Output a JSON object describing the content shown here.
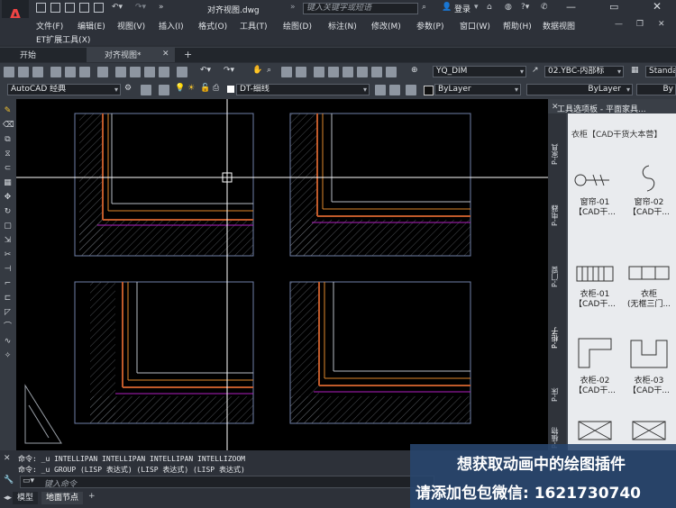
{
  "window": {
    "title": "对齐视图.dwg",
    "search_placeholder": "键入关键字或短语",
    "login_label": "登录"
  },
  "menu": [
    "文件(F)",
    "编辑(E)",
    "视图(V)",
    "插入(I)",
    "格式(O)",
    "工具(T)",
    "绘图(D)",
    "标注(N)",
    "修改(M)",
    "参数(P)",
    "窗口(W)",
    "帮助(H)",
    "数据视图"
  ],
  "et_menu": "ET扩展工具(X)",
  "tabs": [
    {
      "label": "开始"
    },
    {
      "label": "对齐视图*"
    }
  ],
  "toolbar": {
    "dim_style": "YQ_DIM",
    "text_style": "02.YBC-内部标",
    "table_style": "Standa",
    "workspace": "AutoCAD 经典",
    "layer": "DT-细线",
    "color": "ByLayer",
    "linetype": "ByLayer",
    "lineweight": "By"
  },
  "palette": {
    "title": "工具选项板 - 平面家具...",
    "subtitle": "衣柜【CAD干货大本营】",
    "side_tabs": [
      "P-家具",
      "P-电器",
      "P-门窗",
      "P-柜子",
      "P-床",
      "P-植物"
    ],
    "items": [
      {
        "label1": "窗帘-01",
        "label2": "【CAD干..."
      },
      {
        "label1": "窗帘-02",
        "label2": "【CAD干..."
      },
      {
        "label1": "衣柜-01",
        "label2": "【CAD干..."
      },
      {
        "label1": "衣柜",
        "label2": "(无框三门..."
      },
      {
        "label1": "衣柜-02",
        "label2": "【CAD干..."
      },
      {
        "label1": "衣柜-03",
        "label2": "【CAD干..."
      }
    ]
  },
  "command": {
    "line1": "命令: _u INTELLIPAN INTELLIPAN INTELLIPAN INTELLIZOOM",
    "line2": "命令: _u GROUP (LISP 表达式) (LISP 表达式) (LISP 表达式)",
    "input_placeholder": "键入命令"
  },
  "status": {
    "model_tab": "模型",
    "layout_tab": "地面节点"
  },
  "promo": {
    "line1": "想获取动画中的绘图插件",
    "line2": "请添加包包微信: 1621730740"
  },
  "colors": {
    "canvas": "#000000",
    "accent_orange": "#e0892c",
    "hatch": "#9aa0a8",
    "magenta": "#b020c0"
  }
}
